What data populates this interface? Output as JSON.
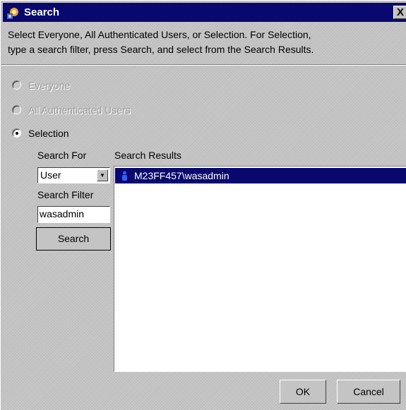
{
  "window": {
    "title": "Search",
    "close_label": "X"
  },
  "instructions": "Select Everyone, All Authenticated Users, or Selection.  For Selection,\ntype a search filter, press Search, and select from the Search Results.",
  "radios": [
    {
      "label": "Everyone",
      "selected": false,
      "enabled": false
    },
    {
      "label": "All Authenticated Users",
      "selected": false,
      "enabled": false
    },
    {
      "label": "Selection",
      "selected": true,
      "enabled": true
    }
  ],
  "search_panel": {
    "search_for_label": "Search For",
    "search_for_value": "User",
    "search_for_options_visible": [
      "User"
    ],
    "filter_label": "Search Filter",
    "filter_value": "wasadmin",
    "search_button": "Search"
  },
  "results": {
    "label": "Search Results",
    "items": [
      {
        "text": "M23FF457\\wasadmin",
        "selected": true,
        "icon": "user-icon"
      }
    ]
  },
  "buttons": {
    "ok": "OK",
    "cancel": "Cancel"
  },
  "colors": {
    "titlebar": "#08086e",
    "selection": "#08086e",
    "background": "#c4c4c4"
  }
}
